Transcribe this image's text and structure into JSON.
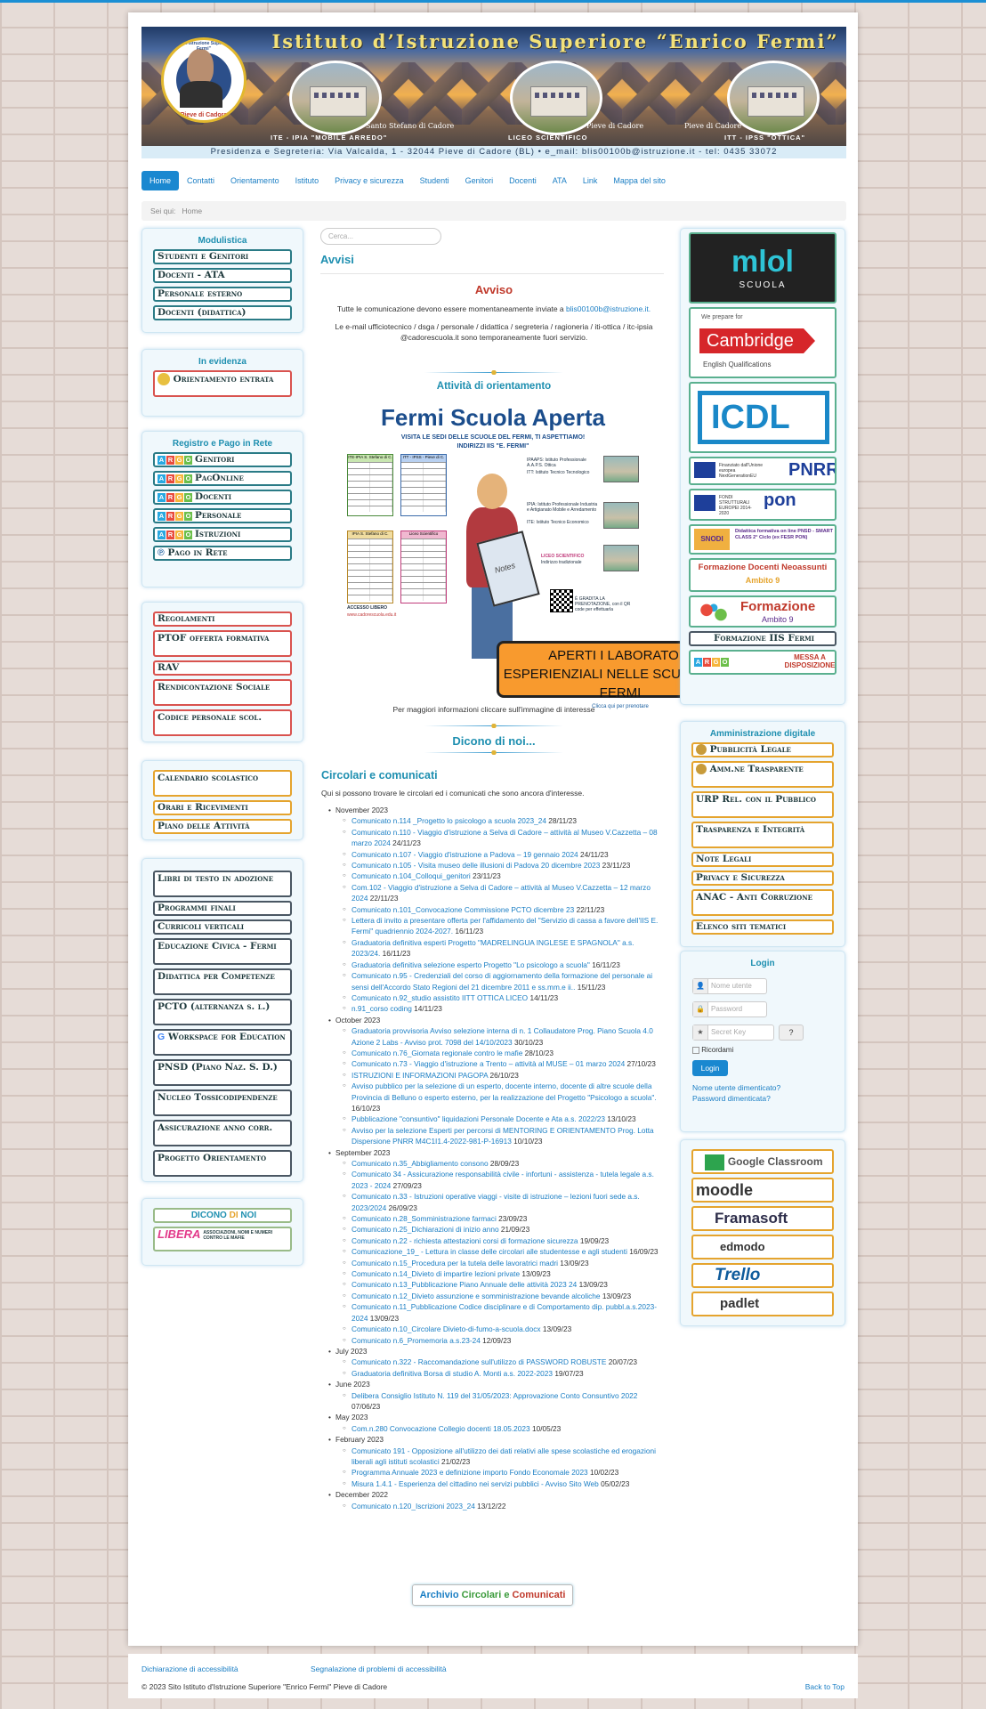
{
  "header": {
    "title": "Istituto d’Istruzione Superiore “Enrico Fermi”",
    "logo_top": "Istituto d'Istruzione Superiore \"E. Fermi\"",
    "logo_bottom": "Pieve di Cadore",
    "cap1": "Santo Stefano di Cadore",
    "cap2": "Pieve di Cadore",
    "cap3": "Pieve di Cadore",
    "sub1": "ITE - IPIA \"MOBILE ARREDO\"",
    "sub2": "LICEO SCIENTIFICO",
    "sub3": "ITT - IPSS \"OTTICA\"",
    "address": "Presidenza e Segreteria: Via Valcalda, 1 - 32044 Pieve di Cadore (BL) • e_mail: blis00100b@istruzione.it - tel: 0435 33072"
  },
  "nav": [
    "Home",
    "Contatti",
    "Orientamento",
    "Istituto",
    "Privacy e sicurezza",
    "Studenti",
    "Genitori",
    "Docenti",
    "ATA",
    "Link",
    "Mappa del sito"
  ],
  "breadcrumb": {
    "label": "Sei qui:",
    "current": "Home"
  },
  "left": {
    "modulistica": {
      "title": "Modulistica",
      "items": [
        "Studenti e Genitori",
        "Docenti - ATA",
        "Personale esterno",
        "Docenti (didattica)"
      ]
    },
    "evidenza": {
      "title": "In evidenza",
      "items": [
        "Orientamento entrata"
      ]
    },
    "registro": {
      "title": "Registro e Pago in Rete",
      "items": [
        "Genitori",
        "PagOnline",
        "Docenti",
        "Personale",
        "Istruzioni"
      ],
      "pago": "Pago in Rete",
      "argo": "ARGO"
    },
    "doc": [
      "Regolamenti",
      "PTOF offerta formativa",
      "RAV",
      "Rendicontazione Sociale",
      "Codice personale scol."
    ],
    "cal": [
      "Calendario scolastico",
      "Orari e Ricevimenti",
      "Piano delle Attività"
    ],
    "did": [
      "Libri di testo in adozione",
      "Programmi finali",
      "Curricoli verticali",
      "Educazione Civica - Fermi",
      "Didattica per Competenze",
      "PCTO (alternanza s. l.)",
      "Workspace for Education",
      "PNSD (Piano Naz. S. D.)",
      "Nucleo Tossicodipendenze",
      "Assicurazione anno corr.",
      "Progetto Orientamento"
    ],
    "dicono": {
      "a": "DICONO",
      "b": "DI",
      "c": "NOI",
      "libera": "LIBERA",
      "libera_sub": "ASSOCIAZIONI, NOMI E NUMERI CONTRO LE MAFIE"
    }
  },
  "main": {
    "search_placeholder": "Cerca...",
    "title": "Avvisi",
    "avviso": "Avviso",
    "p1": "Tutte le comunicazione devono essere momentaneamente inviate a",
    "p1_link": "blis00100b@istruzione.it.",
    "p2": "Le e-mail ufficiotecnico / dsga / personale / didattica / segreteria / ragioneria / iti-ottica / itc-ipsia @cadorescuola.it sono temporaneamente fuori servizio.",
    "orient": "Attività di orientamento",
    "poster": {
      "title": "Fermi Scuola Aperta",
      "sub": "VISITA LE SEDI DELLE SCUOLE DEL FERMI, TI ASPETTIAMO!",
      "sub2": "INDIRIZZI IIS \"E. FERMI\"",
      "t1": "ITE-IPIA S. Stefano di C.",
      "t2": "ITT - IPSS - Pieve di C.",
      "t3": "IPIA S. Stefano di C.",
      "t4": "Liceo Scientifico",
      "ipaaps": "IPAAPS: Istituto Professionale A.A.P.S. Ottica",
      "itt": "ITT: Istituto Tecnico Tecnologico",
      "ipia": "IPIA: Istituto Professionale Industria e Artigianato Mobile e Arredamento",
      "ite": "ITE: Istituto Tecnico Economico",
      "liceo": "LICEO SCIENTIFICO",
      "ind": "Indirizzo tradizionale",
      "accesso": "ACCESSO LIBERO",
      "web": "www.cadorescuola.edu.it",
      "gratis": "È GRADITA LA PRENOTAZIONE, con il QR code per effettuarla",
      "notes": "Notes"
    },
    "orange": "APERTI I LABORATORI ESPERIENZIALI NELLE SCUOLE DEL FERMI",
    "orange_small": "Clicca qui per prenotare",
    "note": "Per maggiori informazioni cliccare sull'immagine di interesse",
    "dicono": "Dicono di noi...",
    "circ_title": "Circolari e comunicati",
    "circ_sub": "Qui si possono trovare le circolari ed i comunicati che sono ancora d'interesse.",
    "archivio": {
      "a": "Archivio",
      "b": "Circolari",
      "c": "e",
      "d": "Comunicati"
    },
    "months": [
      {
        "m": "November 2023",
        "items": [
          [
            "Comunicato n.114 _Progetto lo psicologo a scuola 2023_24",
            "28/11/23"
          ],
          [
            "Comunicato n.110 - Viaggio d'istruzione a Selva di Cadore – attività al Museo V.Cazzetta – 08 marzo 2024",
            "24/11/23"
          ],
          [
            "Comunicato n.107 - Viaggio d'istruzione a Padova – 19 gennaio 2024",
            "24/11/23"
          ],
          [
            "Comunicato n.105 - Visita museo delle illusioni di Padova 20 dicembre 2023",
            "23/11/23"
          ],
          [
            "Comunicato n.104_Colloqui_genitori",
            "23/11/23"
          ],
          [
            "Com.102 - Viaggio d'istruzione a Selva di Cadore – attività al Museo V.Cazzetta – 12 marzo 2024",
            "22/11/23"
          ],
          [
            "Comunicato n.101_Convocazione Commissione PCTO dicembre 23",
            "22/11/23"
          ],
          [
            "Lettera di invito a presentare offerta per l'affidamento del \"Servizio di cassa a favore dell'IIS E. Fermi\" quadriennio 2024-2027.",
            "16/11/23"
          ],
          [
            "Graduatoria definitiva esperti Progetto \"MADRELINGUA INGLESE E SPAGNOLA\" a.s. 2023/24.",
            "16/11/23"
          ],
          [
            "Graduatoria definitiva selezione esperto Progetto \"Lo psicologo a scuola\"",
            "16/11/23"
          ],
          [
            "Comunicato n.95 - Credenziali del corso di aggiornamento della formazione del personale ai sensi dell'Accordo Stato Regioni del 21 dicembre 2011 e ss.mm.e ii..",
            "15/11/23"
          ],
          [
            "Comunicato n.92_studio assistito IITT OTTICA LICEO",
            "14/11/23"
          ],
          [
            "n.91_corso coding",
            "14/11/23"
          ]
        ]
      },
      {
        "m": "October 2023",
        "items": [
          [
            "Graduatoria provvisoria Avviso selezione interna di n. 1 Collaudatore Prog. Piano Scuola 4.0 Azione 2 Labs - Avviso prot. 7098 del 14/10/2023",
            "30/10/23"
          ],
          [
            "Comunicato n.76_Giornata regionale contro le mafie",
            "28/10/23"
          ],
          [
            "Comunicato n.73 - Viaggio d'istruzione a Trento – attività al MUSE – 01 marzo 2024",
            "27/10/23"
          ],
          [
            "ISTRUZIONI E INFORMAZIONI PAGOPA",
            "26/10/23"
          ],
          [
            "Avviso pubblico per la selezione di un esperto, docente interno, docente di altre scuole della Provincia di Belluno o esperto esterno, per la realizzazione del Progetto \"Psicologo a scuola\".",
            "16/10/23"
          ],
          [
            "Pubblicazione \"consuntivo\" liquidazioni Personale Docente e Ata a.s. 2022/23",
            "13/10/23"
          ],
          [
            "Avviso per la selezione Esperti per percorsi di MENTORING E ORIENTAMENTO Prog. Lotta Dispersione PNRR M4C1I1.4-2022-981-P-16913",
            "10/10/23"
          ]
        ]
      },
      {
        "m": "September 2023",
        "items": [
          [
            "Comunicato n.35_Abbigliamento consono",
            "28/09/23"
          ],
          [
            "Comunicato 34 - Assicurazione responsabilità civile - infortuni - assistenza - tutela legale a.s. 2023 - 2024",
            "27/09/23"
          ],
          [
            "Comunicato n.33 - Istruzioni operative viaggi - visite di istruzione – lezioni fuori sede a.s. 2023/2024",
            "26/09/23"
          ],
          [
            "Comunicato n.28_Somministrazione farmaci",
            "23/09/23"
          ],
          [
            "Comunicato n.25_Dichiarazioni di inizio anno",
            "21/09/23"
          ],
          [
            "Comunicato n.22 - richiesta attestazioni corsi di formazione sicurezza",
            "19/09/23"
          ],
          [
            "Comunicazione_19_ - Lettura in classe delle circolari alle studentesse e agli studenti",
            "16/09/23"
          ],
          [
            "Comunicato n.15_Procedura per la tutela delle lavoratrici madri",
            "13/09/23"
          ],
          [
            "Comunicato n.14_Divieto di impartire lezioni private",
            "13/09/23"
          ],
          [
            "Comunicato n.13_Pubblicazione Piano Annuale delle attività 2023 24",
            "13/09/23"
          ],
          [
            "Comunicato n.12_Divieto assunzione e somministrazione bevande alcoliche",
            "13/09/23"
          ],
          [
            "Comunicato n.11_Pubblicazione Codice disciplinare e di Comportamento dip. pubbl.a.s.2023-2024",
            "13/09/23"
          ],
          [
            "Comunicato n.10_Circolare Divieto-di-fumo-a-scuola.docx",
            "13/09/23"
          ],
          [
            "Comunicato n.6_Promemoria a.s.23-24",
            "12/09/23"
          ]
        ]
      },
      {
        "m": "July 2023",
        "items": [
          [
            "Comunicato n.322 - Raccomandazione sull'utilizzo di PASSWORD ROBUSTE",
            "20/07/23"
          ],
          [
            "Graduatoria definitiva Borsa di studio A. Monti a.s. 2022-2023",
            "19/07/23"
          ]
        ]
      },
      {
        "m": "June 2023",
        "items": [
          [
            "Delibera Consiglio Istituto N. 119 del 31/05/2023: Approvazione Conto Consuntivo 2022",
            "07/06/23"
          ]
        ]
      },
      {
        "m": "May 2023",
        "items": [
          [
            "Com.n.280 Convocazione Collegio docenti 18.05.2023",
            "10/05/23"
          ]
        ]
      },
      {
        "m": "February 2023",
        "items": [
          [
            "Comunicato 191 - Opposizione all'utilizzo dei dati relativi alle spese scolastiche ed erogazioni liberali agli istituti scolastici",
            "21/02/23"
          ],
          [
            "Programma Annuale 2023 e definizione importo Fondo Economale 2023",
            "10/02/23"
          ],
          [
            "Misura 1.4.1 - Esperienza del cittadino nei servizi pubblici - Avviso Sito Web",
            "05/02/23"
          ]
        ]
      },
      {
        "m": "December 2022",
        "items": [
          [
            "Comunicato n.120_Iscrizioni 2023_24",
            "13/12/22"
          ]
        ]
      }
    ]
  },
  "right": {
    "mlol": "mlol",
    "mlol_sub": "SCUOLA",
    "cam_pre": "We prepare for",
    "cam": "Cambridge",
    "cam_sub": "English Qualifications",
    "icdl": "ICDL",
    "pnrr": "PNRR",
    "pnrr_sub": "Finanziato dall'Unione europea NextGenerationEU",
    "pon": "pon",
    "pon_sub": "FONDI STRUTTURALI EUROPEI 2014-2020",
    "snodi": "SNODI",
    "snodi_sub": "Didattica formativa on line PNSD - SMART CLASS 2° Ciclo (ex FESR PON)",
    "form": "Formazione Docenti Neoassunti",
    "form_sub": "Ambito 9",
    "form9": "Formazione",
    "form9_sub": "Ambito 9",
    "iis": "Formazione IIS Fermi",
    "argo_mad": "MESSA A DISPOSIZIONE",
    "amm": {
      "title": "Amministrazione digitale",
      "items": [
        "Pubblicità Legale",
        "Amm.ne Trasparente",
        "URP Rel. con il Pubblico",
        "Trasparenza e Integrità",
        "Note Legali",
        "Privacy e Sicurezza",
        "ANAC - Anti Corruzione",
        "Elenco siti tematici"
      ]
    },
    "login": {
      "title": "Login",
      "user": "Nome utente",
      "pass": "Password",
      "key": "Secret Key",
      "remember": "Ricordami",
      "btn": "Login",
      "forgot_user": "Nome utente dimenticato?",
      "forgot_pass": "Password dimenticata?"
    },
    "tools": [
      "Google Classroom",
      "moodle",
      "Framasoft",
      "edmodo",
      "Trello",
      "padlet"
    ]
  },
  "footer": {
    "a1": "Dichiarazione di accessibilità",
    "a2": "Segnalazione di problemi di accessibilità",
    "copy": "© 2023 Sito Istituto d'Istruzione Superiore \"Enrico Fermi\" Pieve di Cadore",
    "top": "Back to Top"
  }
}
